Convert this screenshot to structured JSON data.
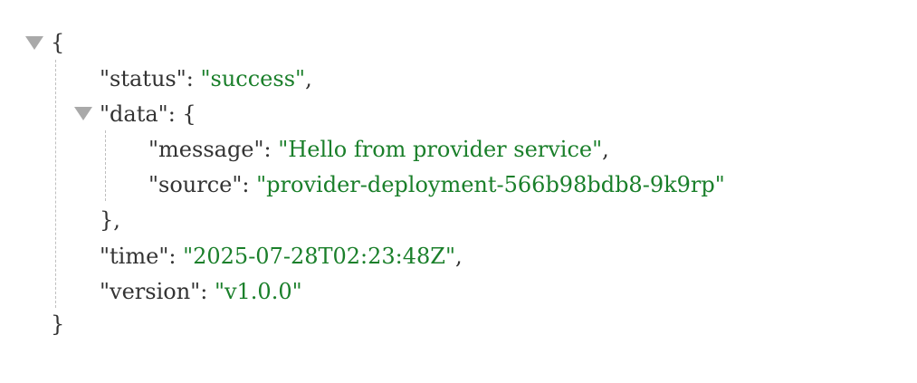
{
  "json_viewer": {
    "root_open": "{",
    "root_close": "}",
    "status_key": "\"status\"",
    "status_value": "\"success\"",
    "data_key": "\"data\"",
    "data_open": "{",
    "data_close": "},",
    "message_key": "\"message\"",
    "message_value": "\"Hello from provider service\"",
    "source_key": "\"source\"",
    "source_value": "\"provider-deployment-566b98bdb8-9k9rp\"",
    "time_key": "\"time\"",
    "time_value": "\"2025-07-28T02:23:48Z\"",
    "version_key": "\"version\"",
    "version_value": "\"v1.0.0\"",
    "colon": ": ",
    "comma": ","
  },
  "colors": {
    "string": "#1a7f2a",
    "text": "#333333",
    "toggle": "#a9a9a9",
    "guide": "#bfbfbf"
  },
  "icons": [
    "collapse-toggle-icon"
  ]
}
